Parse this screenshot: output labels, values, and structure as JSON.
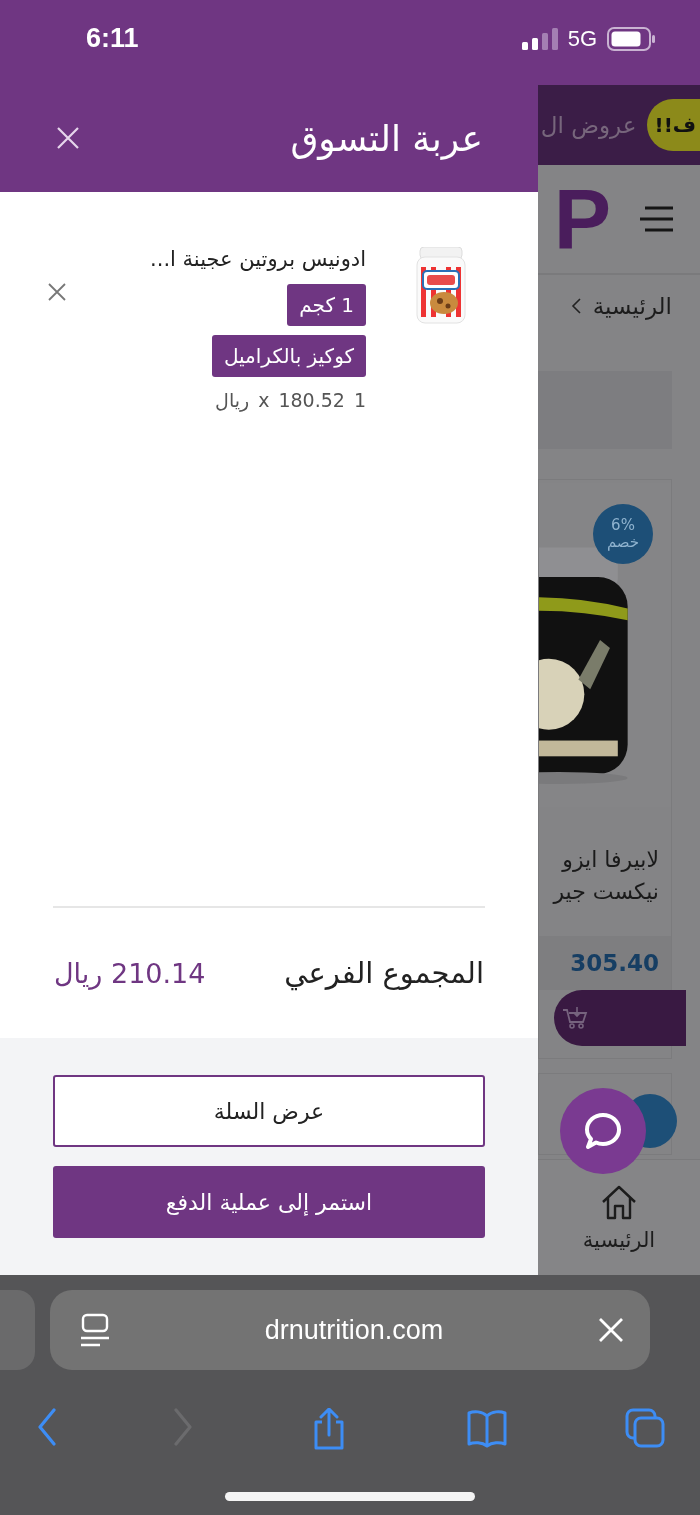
{
  "status_bar": {
    "time": "6:11",
    "network": "5G"
  },
  "cart_drawer": {
    "title": "عربة التسوق",
    "items": [
      {
        "name": "ادونيس بروتين عجينة ا...",
        "options": [
          "1 كجم",
          "كوكيز بالكراميل"
        ],
        "quantity": "1",
        "price": "180.52",
        "times": "x",
        "currency": "ريال"
      }
    ],
    "subtotal_label": "المجموع الفرعي",
    "subtotal_value": "210.14 ريال",
    "buttons": [
      {
        "label": "عرض السلة",
        "kind": "outline"
      },
      {
        "label": "استمر إلى عملية الدفع",
        "kind": "filled"
      }
    ]
  },
  "background_page": {
    "promo_banner": {
      "badge": "ف!!",
      "text": "عروض ال"
    },
    "logo": "P",
    "breadcrumb": "الرئيسية",
    "product": {
      "discount": "6%",
      "discount_label": "خصم",
      "name_lines": [
        "لابيرفا ايزو",
        "نيكست جير"
      ],
      "price": "305.40"
    },
    "bottom_nav": [
      {
        "label": "الرئيسية"
      }
    ]
  },
  "browser": {
    "url": "drnutrition.com",
    "toolbar": [
      {
        "kind": "back",
        "disabled": false
      },
      {
        "kind": "forward",
        "disabled": true
      },
      {
        "kind": "share",
        "disabled": false
      },
      {
        "kind": "bookmarks",
        "disabled": false
      },
      {
        "kind": "tabs",
        "disabled": false
      }
    ]
  }
}
